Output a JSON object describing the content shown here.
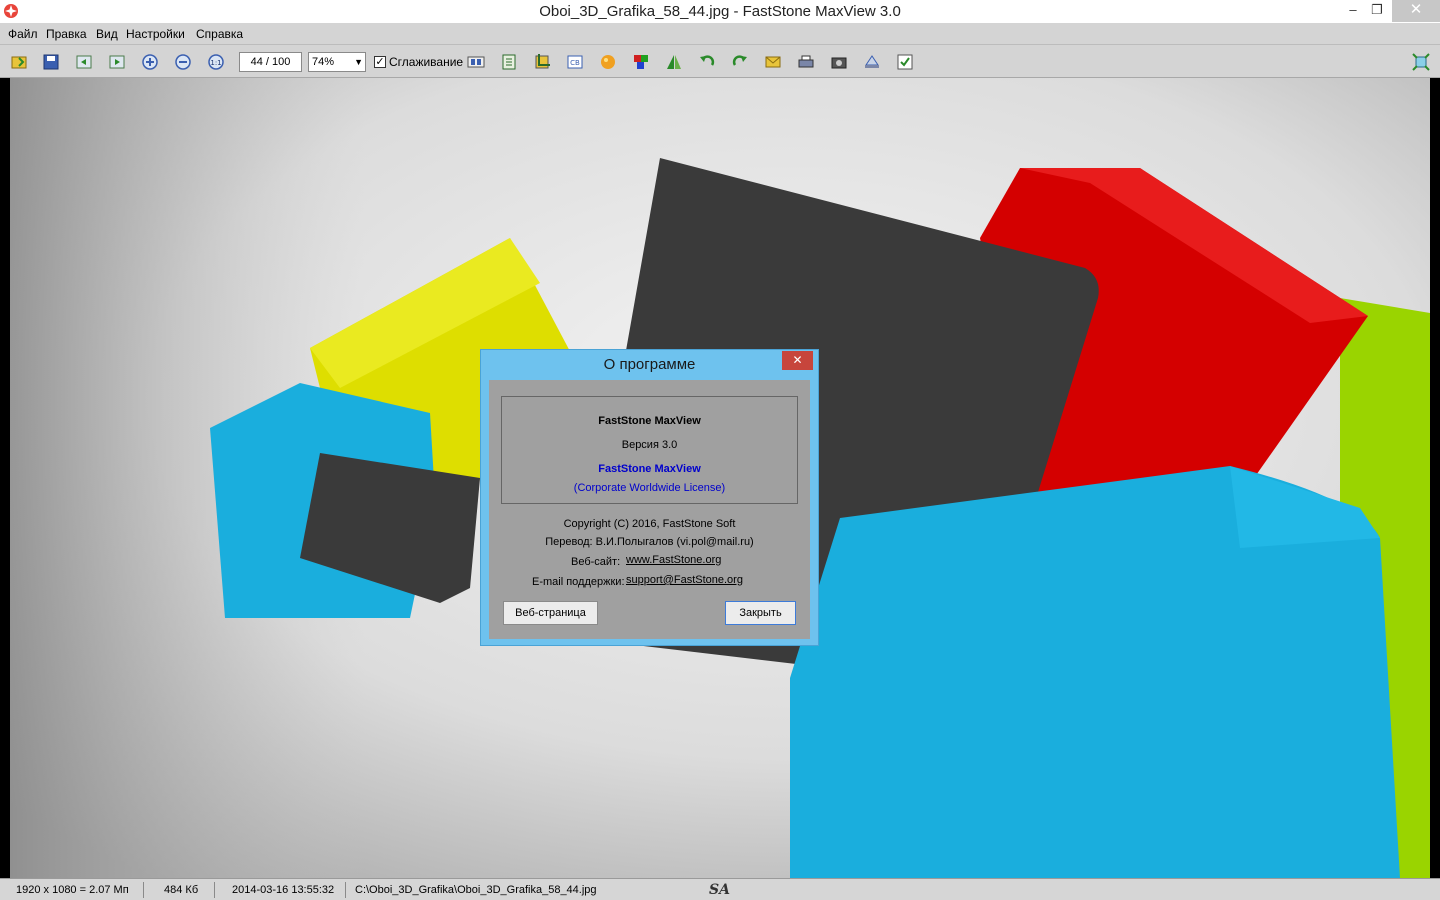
{
  "window": {
    "title": "Oboi_3D_Grafika_58_44.jpg - FastStone MaxView 3.0",
    "min_glyph": "–",
    "max_glyph": "❐",
    "close_glyph": "✕"
  },
  "menu": {
    "items": [
      "Файл",
      "Правка",
      "Вид",
      "Настройки",
      "Справка"
    ]
  },
  "toolbar": {
    "page_counter": "44 / 100",
    "zoom": "74%",
    "smoothing_label": "Сглаживание",
    "smoothing_checked": true,
    "icons": [
      "open-icon",
      "save-icon",
      "prev-icon",
      "next-icon",
      "zoom-in-icon",
      "zoom-out-icon",
      "actual-size-icon",
      "slideshow-icon",
      "fit-icon",
      "crop-icon",
      "convert-icon",
      "color-icon",
      "colors-icon",
      "flip-icon",
      "rotate-left-icon",
      "rotate-right-icon",
      "email-icon",
      "print-icon",
      "camera-icon",
      "scanner-icon",
      "settings-icon",
      "fullscreen-icon"
    ]
  },
  "status": {
    "resolution": "1920 x 1080 = 2.07 Мп",
    "filesize": "484 Кб",
    "datetime": "2014-03-16 13:55:32",
    "path": "C:\\Oboi_3D_Grafika\\Oboi_3D_Grafika_58_44.jpg",
    "logo": "SA"
  },
  "dialog": {
    "title": "О программе",
    "close_glyph": "✕",
    "product": "FastStone MaxView",
    "version": "Версия 3.0",
    "license_name": "FastStone MaxView",
    "license_type": "(Corporate Worldwide License)",
    "copyright": "Copyright (C) 2016, FastStone Soft",
    "translation": "Перевод: В.И.Полыгалов (vi.pol@mail.ru)",
    "website_label": "Веб-сайт:",
    "website_url": "www.FastStone.org",
    "email_label": "E-mail поддержки:",
    "email_value": "support@FastStone.org",
    "web_button": "Веб-страница",
    "close_button": "Закрыть"
  },
  "colors": {
    "dialog_frame": "#6ec2ee",
    "dialog_body": "#a0a0a0",
    "license_text": "#0000cc",
    "cube_yellow": "#dede00",
    "cube_red": "#d40000",
    "cube_blue": "#1aaedd",
    "cube_dark": "#3a3a3a",
    "cube_green": "#9ad400"
  }
}
